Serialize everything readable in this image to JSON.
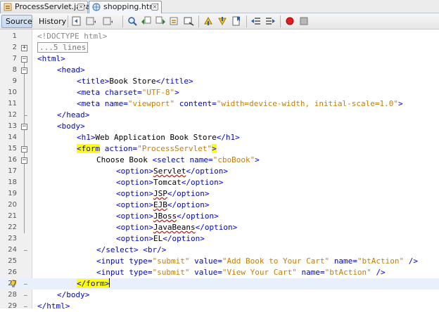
{
  "tabs": [
    {
      "label": "ProcessServlet.java",
      "close": "×",
      "icon": "java-file-icon"
    },
    {
      "label": "shopping.html",
      "close": "×",
      "icon": "html-file-icon"
    }
  ],
  "toolbar": {
    "source_label": "Source",
    "history_label": "History"
  },
  "editor": {
    "current_line": 27,
    "lines": [
      {
        "n": "1"
      },
      {
        "n": "2"
      },
      {
        "n": "7"
      },
      {
        "n": "8"
      },
      {
        "n": "9"
      },
      {
        "n": "10"
      },
      {
        "n": "11"
      },
      {
        "n": "12"
      },
      {
        "n": "13"
      },
      {
        "n": "14"
      },
      {
        "n": "15"
      },
      {
        "n": "16"
      },
      {
        "n": "17"
      },
      {
        "n": "18"
      },
      {
        "n": "19"
      },
      {
        "n": "20"
      },
      {
        "n": "21"
      },
      {
        "n": "22"
      },
      {
        "n": "23"
      },
      {
        "n": "24"
      },
      {
        "n": "25"
      },
      {
        "n": "26"
      },
      {
        "n": "27"
      },
      {
        "n": "28"
      },
      {
        "n": "29"
      }
    ],
    "text": {
      "doctype": "<!DOCTYPE html>",
      "collapsed": "...5 lines",
      "html_open": "<html>",
      "head_open": "<head>",
      "title_open": "<title>",
      "title_text": "Book Store",
      "title_close": "</title>",
      "meta1_tag": "<meta",
      "meta1_attr": "charset=",
      "meta1_val": "\"UTF-8\"",
      "meta1_end": ">",
      "meta2_tag": "<meta",
      "meta2_a1": "name=",
      "meta2_v1": "\"viewport\"",
      "meta2_a2": "content=",
      "meta2_v2": "\"width=device-width, initial-scale=1.0\"",
      "meta2_end": ">",
      "head_close": "</head>",
      "body_open": "<body>",
      "h1_open": "<h1>",
      "h1_text": "Web Application Book Store",
      "h1_close": "</h1>",
      "form_tag": "<form",
      "form_attr": "action=",
      "form_val": "\"ProcessServlet\"",
      "form_end": ">",
      "choose_text": "Choose Book ",
      "select_tag": "<select",
      "select_attr": "name=",
      "select_val": "\"cboBook\"",
      "select_end": ">",
      "opt_open": "<option>",
      "opt_close": "</option>",
      "options": [
        "Servlet",
        "Tomcat",
        "JSP",
        "EJB",
        "JBoss",
        "JavaBeans",
        "EL"
      ],
      "select_close": "</select>",
      "br": "<br/>",
      "input_tag": "<input",
      "type_attr": "type=",
      "type_val": "\"submit\"",
      "value_attr": "value=",
      "value1": "\"Add Book to Your Cart\"",
      "value2": "\"View Your Cart\"",
      "name_attr": "name=",
      "name_val": "\"btAction\"",
      "input_end": "/>",
      "form_close": "</form>",
      "body_close": "</body>",
      "html_close": "</html>"
    }
  },
  "colors": {
    "tag": "#0000e6",
    "attr_value": "#ce7b00",
    "match_highlight": "#ffff00",
    "current_line": "#e9effb"
  }
}
